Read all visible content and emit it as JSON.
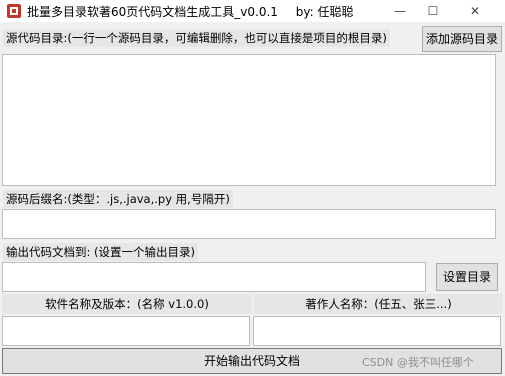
{
  "window": {
    "title": "批量多目录软著60页代码文档生成工具_v0.0.1",
    "author": "by: 任聪聪",
    "minimize_glyph": "—",
    "maximize_glyph": "☐",
    "close_glyph": "✕"
  },
  "source_dir": {
    "label": "源代码目录:(一行一个源码目录，可编辑删除，也可以直接是项目的根目录)",
    "add_button": "添加源码目录",
    "value": ""
  },
  "suffix": {
    "label": "源码后缀名:(类型：.js,.java,.py 用,号隔开)",
    "value": ""
  },
  "output": {
    "label": "输出代码文档到: (设置一个输出目录)",
    "value": "",
    "set_button": "设置目录"
  },
  "software": {
    "label": "软件名称及版本：(名称 v1.0.0)",
    "value": ""
  },
  "authors": {
    "label": "著作人名称：(任五、张三...)",
    "value": ""
  },
  "start_button": "开始输出代码文档",
  "watermark": "CSDN @我不叫任哪个"
}
